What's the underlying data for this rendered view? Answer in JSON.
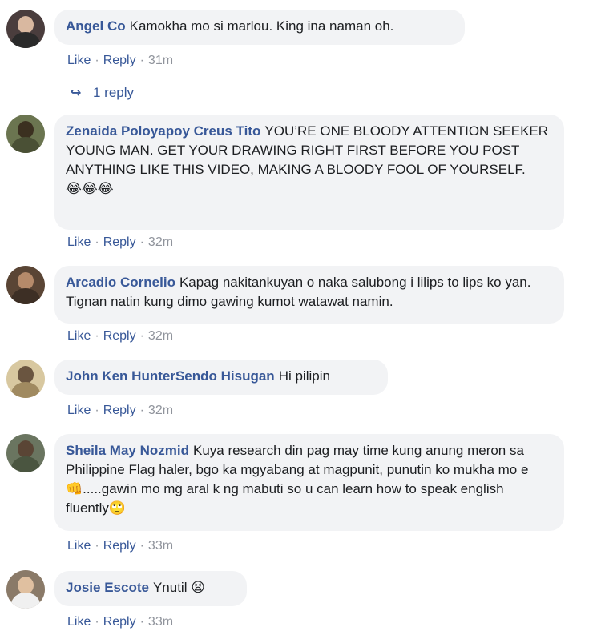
{
  "comments": [
    {
      "author": "Angel Co",
      "text": "Kamokha mo si marlou. King ina naman oh.",
      "emoji": "",
      "like": "Like",
      "reply": "Reply",
      "time": "31m",
      "avatar_color": "#6b5a5a"
    },
    {
      "author": "Zenaida Poloyapoy Creus Tito",
      "text": "YOU’RE ONE BLOODY ATTENTION SEEKER YOUNG MAN. GET YOUR DRAWING RIGHT FIRST BEFORE YOU POST ANYTHING LIKE THIS VIDEO, MAKING A BLOODY FOOL OF YOURSELF.",
      "emoji": "😂😂😂",
      "like": "Like",
      "reply": "Reply",
      "time": "32m",
      "avatar_color": "#5c6448"
    },
    {
      "author": "Arcadio Cornelio",
      "text": "Kapag nakitankuyan o naka salubong i lilips to lips ko yan. Tignan natin kung dimo gawing kumot watawat namin.",
      "emoji": "",
      "like": "Like",
      "reply": "Reply",
      "time": "32m",
      "avatar_color": "#7a5a45"
    },
    {
      "author": "John Ken HunterSendo Hisugan",
      "text": "Hi pilipin",
      "emoji": "",
      "like": "Like",
      "reply": "Reply",
      "time": "32m",
      "avatar_color": "#c8b48a"
    },
    {
      "author": "Sheila May Nozmid",
      "text": "Kuya research din pag may time kung anung meron sa Philippine Flag haler, bgo ka mgyabang at magpunit, punutin ko mukha mo e👊.....gawin mo mg aral k ng mabuti so u can learn how to speak english fluently🙄",
      "emoji": "",
      "like": "Like",
      "reply": "Reply",
      "time": "33m",
      "avatar_color": "#5d6a55"
    },
    {
      "author": "Josie Escote",
      "text": "Ynutil",
      "emoji": "😫",
      "like": "Like",
      "reply": "Reply",
      "time": "33m",
      "avatar_color": "#8a7a6a"
    }
  ],
  "replies": {
    "label": "1 reply"
  },
  "colors": {
    "author": "#385898",
    "bubble": "#f2f3f5",
    "meta": "#90949c"
  }
}
